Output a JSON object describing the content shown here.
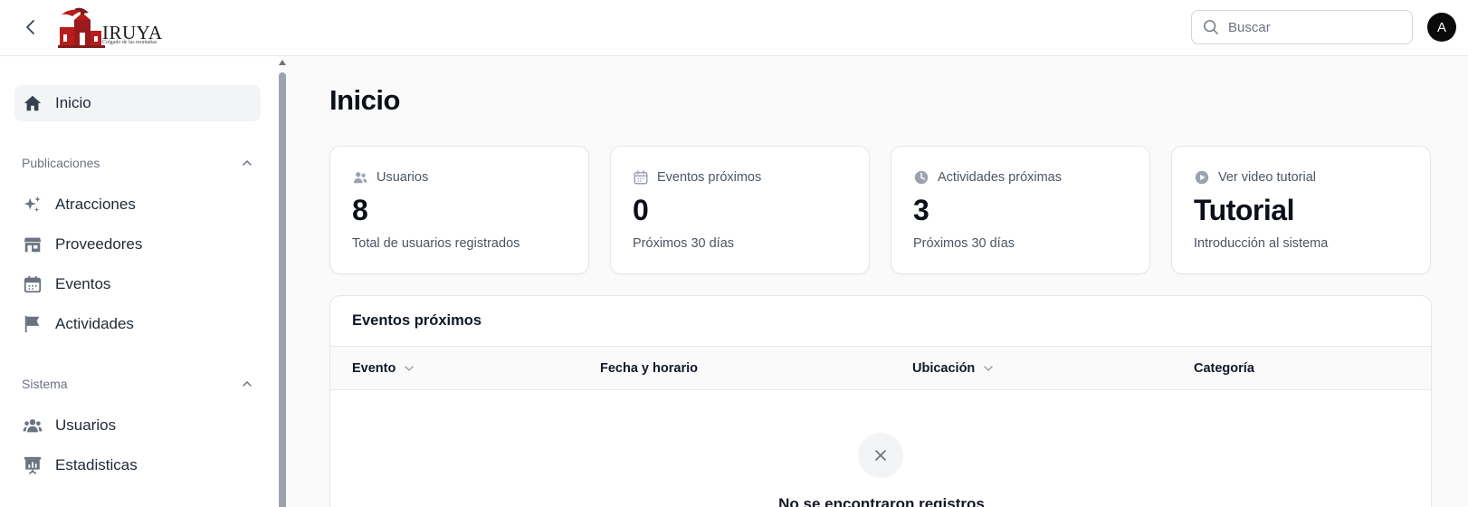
{
  "header": {
    "logo_text": "IRUYA",
    "logo_subtitle": "Colgado de las montañas",
    "search": {
      "placeholder": "Buscar",
      "value": ""
    },
    "avatar_initial": "A"
  },
  "sidebar": {
    "home": {
      "label": "Inicio",
      "icon": "home-icon"
    },
    "groups": [
      {
        "label": "Publicaciones",
        "items": [
          {
            "label": "Atracciones",
            "icon": "sparkles-icon"
          },
          {
            "label": "Proveedores",
            "icon": "storefront-icon"
          },
          {
            "label": "Eventos",
            "icon": "calendar-icon"
          },
          {
            "label": "Actividades",
            "icon": "flag-icon"
          }
        ]
      },
      {
        "label": "Sistema",
        "items": [
          {
            "label": "Usuarios",
            "icon": "users-icon"
          },
          {
            "label": "Estadisticas",
            "icon": "presentation-chart-icon"
          }
        ]
      }
    ]
  },
  "main": {
    "title": "Inicio",
    "stats": [
      {
        "label": "Usuarios",
        "value": "8",
        "description": "Total de usuarios registrados",
        "icon": "users-icon"
      },
      {
        "label": "Eventos próximos",
        "value": "0",
        "description": "Próximos 30 días",
        "icon": "calendar-icon"
      },
      {
        "label": "Actividades próximas",
        "value": "3",
        "description": "Próximos 30 días",
        "icon": "clock-icon"
      },
      {
        "label": "Ver video tutorial",
        "value": "Tutorial",
        "description": "Introducción al sistema",
        "icon": "play-circle-icon"
      }
    ],
    "events_table": {
      "title": "Eventos próximos",
      "columns": [
        "Evento",
        "Fecha y horario",
        "Ubicación",
        "Categoría"
      ],
      "rows": [],
      "empty_message": "No se encontraron registros"
    }
  },
  "colors": {
    "accent": "#0a0a0a",
    "muted_text": "#6b7280",
    "border": "#e5e7eb",
    "logo_red": "#b91c1c"
  }
}
